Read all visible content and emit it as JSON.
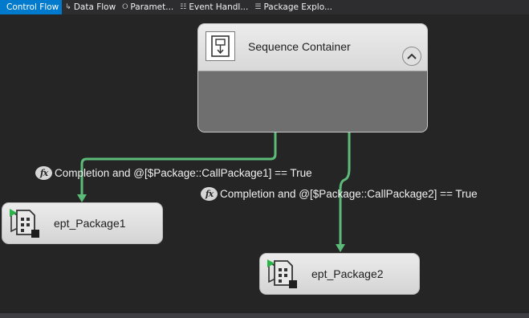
{
  "tabs": [
    {
      "label": "Control Flow",
      "icon": "control-flow-icon",
      "active": true
    },
    {
      "label": "Data Flow",
      "icon": "data-flow-icon",
      "active": false
    },
    {
      "label": "Paramet...",
      "icon": "parameters-icon",
      "active": false
    },
    {
      "label": "Event Handl...",
      "icon": "event-handlers-icon",
      "active": false
    },
    {
      "label": "Package Explo...",
      "icon": "package-explorer-icon",
      "active": false
    }
  ],
  "sequence_container": {
    "title": "Sequence Container",
    "icon": "sequence-container-icon",
    "collapse_icon": "chevron-up-icon"
  },
  "tasks": [
    {
      "label": "ept_Package1",
      "icon": "execute-package-task-icon"
    },
    {
      "label": "ept_Package2",
      "icon": "execute-package-task-icon"
    }
  ],
  "constraints": [
    {
      "expression": "Completion and @[$Package::CallPackage1] == True",
      "icon": "fx-expression-icon"
    },
    {
      "expression": "Completion and @[$Package::CallPackage2] == True",
      "icon": "fx-expression-icon"
    }
  ],
  "colors": {
    "canvas_background": "#252526",
    "active_tab": "#007acc",
    "success_connector": "#5dbb79"
  }
}
